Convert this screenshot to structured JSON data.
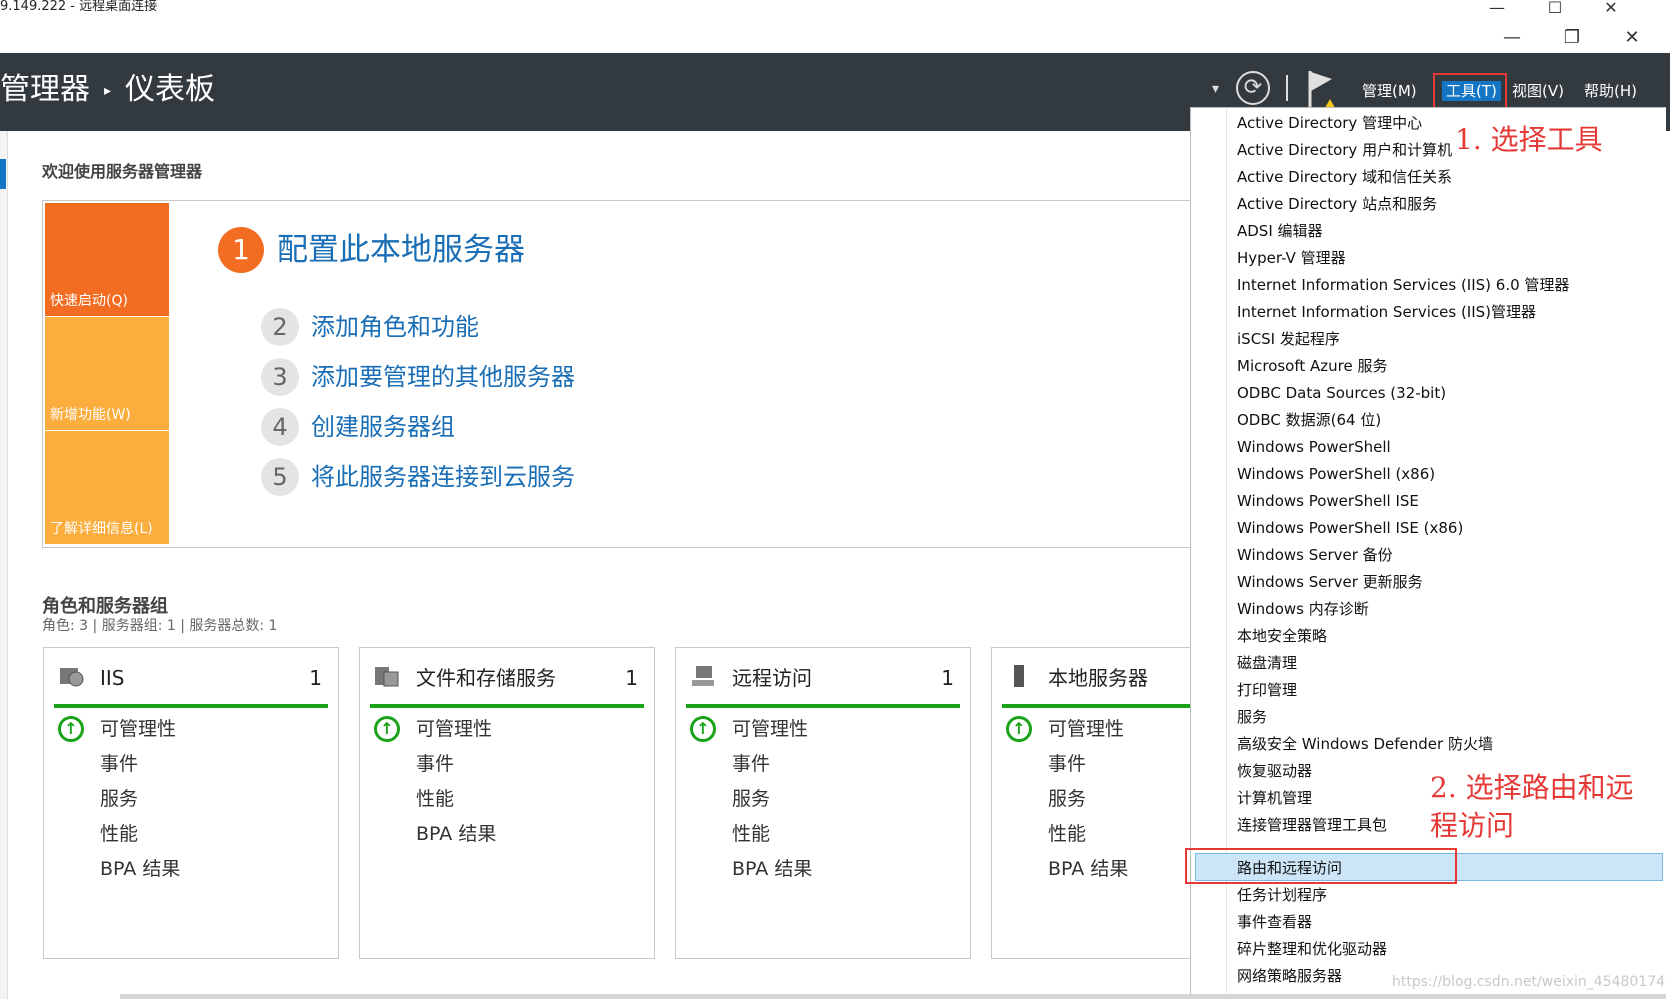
{
  "rdp": {
    "title": "9.149.222 - 远程桌面连接",
    "min": "—",
    "max": "☐",
    "close": "✕"
  },
  "window_controls": {
    "min": "—",
    "restore": "❐",
    "close": "✕"
  },
  "header": {
    "app": "管理器",
    "separator": "▸",
    "page": "仪表板",
    "dropdown_arrow": "▾",
    "refresh_icon": "⟳",
    "menus": {
      "manage": "管理(M)",
      "tools": "工具(T)",
      "view": "视图(V)",
      "help": "帮助(H)"
    }
  },
  "welcome": {
    "title": "欢迎使用服务器管理器",
    "tiles": [
      "快速启动(Q)",
      "新增功能(W)",
      "了解详细信息(L)"
    ],
    "steps": [
      {
        "num": "1",
        "text": "配置此本地服务器"
      },
      {
        "num": "2",
        "text": "添加角色和功能"
      },
      {
        "num": "3",
        "text": "添加要管理的其他服务器"
      },
      {
        "num": "4",
        "text": "创建服务器组"
      },
      {
        "num": "5",
        "text": "将此服务器连接到云服务"
      }
    ]
  },
  "roles": {
    "title": "角色和服务器组",
    "subtitle": "角色: 3 | 服务器组: 1 | 服务器总数: 1",
    "ok_mark": "↑",
    "cards": [
      {
        "title": "IIS",
        "count": "1",
        "rows": [
          "可管理性",
          "事件",
          "服务",
          "性能",
          "BPA 结果"
        ]
      },
      {
        "title": "文件和存储服务",
        "count": "1",
        "rows": [
          "可管理性",
          "事件",
          "性能",
          "BPA 结果"
        ]
      },
      {
        "title": "远程访问",
        "count": "1",
        "rows": [
          "可管理性",
          "事件",
          "服务",
          "性能",
          "BPA 结果"
        ]
      },
      {
        "title": "本地服务器",
        "count": "",
        "rows": [
          "可管理性",
          "事件",
          "服务",
          "性能",
          "BPA 结果"
        ]
      }
    ]
  },
  "tools_menu": [
    "Active Directory 管理中心",
    "Active Directory 用户和计算机",
    "Active Directory 域和信任关系",
    "Active Directory 站点和服务",
    "ADSI 编辑器",
    "Hyper-V 管理器",
    "Internet Information Services (IIS) 6.0 管理器",
    "Internet Information Services (IIS)管理器",
    "iSCSI 发起程序",
    "Microsoft Azure 服务",
    "ODBC Data Sources (32-bit)",
    "ODBC 数据源(64 位)",
    "Windows PowerShell",
    "Windows PowerShell (x86)",
    "Windows PowerShell ISE",
    "Windows PowerShell ISE (x86)",
    "Windows Server 备份",
    "Windows Server 更新服务",
    "Windows 内存诊断",
    "本地安全策略",
    "磁盘清理",
    "打印管理",
    "服务",
    "高级安全 Windows Defender 防火墙",
    "恢复驱动器",
    "计算机管理",
    "连接管理器管理工具包",
    "路由和远程访问",
    "任务计划程序",
    "事件查看器",
    "碎片整理和优化驱动器",
    "网络策略服务器"
  ],
  "annotations": {
    "step1": "1. 选择工具",
    "step2_line1": "2. 选择路由和远",
    "step2_line2": "程访问"
  },
  "watermark": "https://blog.csdn.net/weixin_45480174"
}
